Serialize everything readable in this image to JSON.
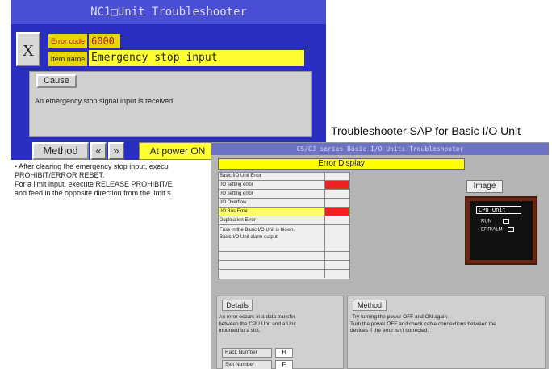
{
  "window1": {
    "title": "NC1□Unit Troubleshooter",
    "close_label": "X",
    "error_code_label": "Error code",
    "error_code_value": "6000",
    "item_name_label": "Item name",
    "item_name_value": "Emergency stop input",
    "cause_button": "Cause",
    "cause_text": "An emergency stop signal input is received.",
    "method_button": "Method",
    "prev_label": "«",
    "next_label": "»",
    "timing_label": "At power ON",
    "method_lines": [
      "• After clearing the emergency stop input, execu",
      "PROHIBIT/ERROR RESET.",
      "For a limit input, execute RELEASE PROHIBIT/E",
      "and feed in the opposite direction from the limit s"
    ]
  },
  "caption": "Troubleshooter SAP for Basic I/O Unit",
  "window2": {
    "title": "CS/CJ series Basic I/O Units Troubleshooter",
    "error_display_label": "Error Display",
    "error_rows": [
      {
        "label": "Basic I/O Unit Error",
        "flag": false,
        "highlight": false
      },
      {
        "label": "I/O setting error",
        "flag": true,
        "highlight": false
      },
      {
        "label": "I/O setting error",
        "flag": false,
        "highlight": false
      },
      {
        "label": "I/O Overflow",
        "flag": false,
        "highlight": false
      },
      {
        "label": "I/O Bus Error",
        "flag": true,
        "highlight": true
      },
      {
        "label": "Duplication Error",
        "flag": false,
        "highlight": false
      }
    ],
    "fuse_lines": [
      "Fuse in the Basic I/O Unit is blown.",
      "Basic I/O Unit alarm output"
    ],
    "image_button": "Image",
    "cpu_unit_label": "CPU Unit",
    "run_label": "RUN",
    "erralm_label": "ERR/ALM",
    "details_button": "Details",
    "details_lines": [
      "An error occurs in a data transfer",
      "between the CPU Unit  and a Unit",
      "mounted to a slot."
    ],
    "rack_number_label": "Rack Number",
    "rack_number_value": "B",
    "slot_number_label": "Slot Number",
    "slot_number_value": "F",
    "method_button": "Method",
    "method_lines": [
      "-Try turning the power OFF and ON again.",
      " Turn the power OFF and check cable connections between the",
      " devices if the error isn't corrected."
    ],
    "colors": {
      "flag_red": "#ee2222",
      "highlight_yellow": "#ffff66",
      "title_blue": "#6e72c4"
    }
  },
  "colors": {
    "window1_bg": "#2a2ec0",
    "label_yellow": "#e8d600",
    "value_yellow": "#ffff33"
  }
}
